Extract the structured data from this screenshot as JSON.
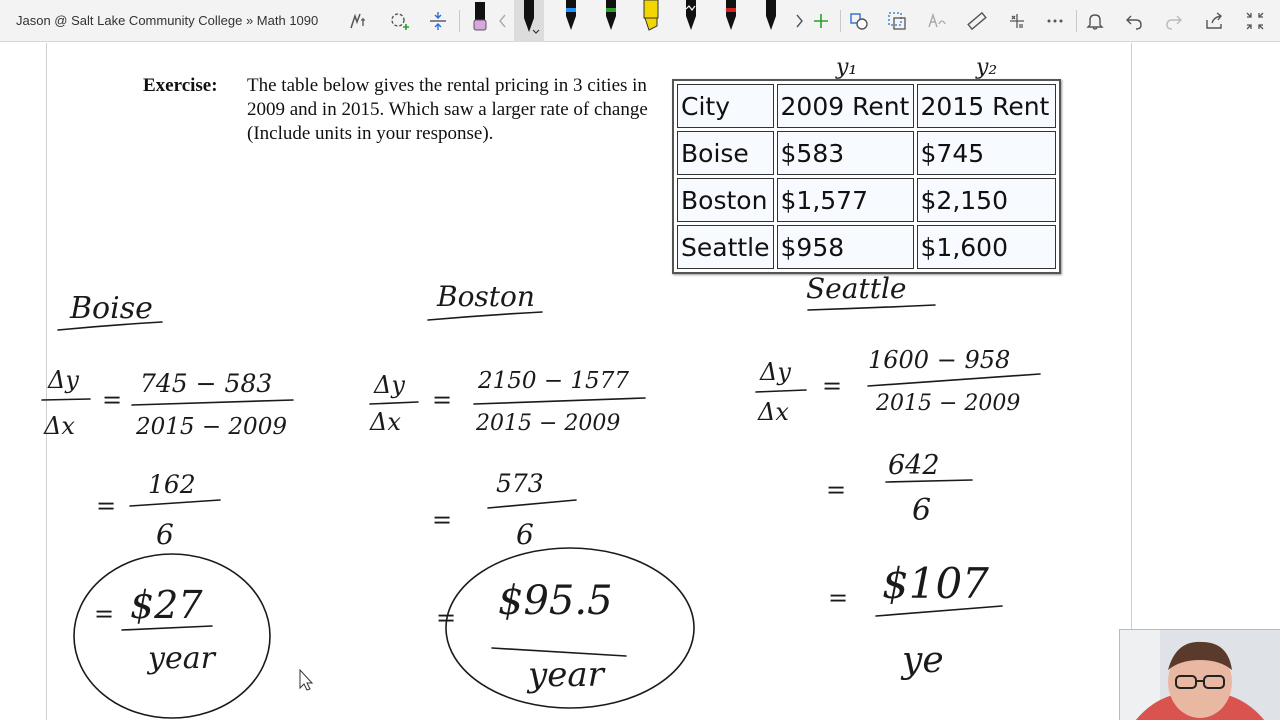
{
  "breadcrumb": "Jason @ Salt Lake Community College » Math 1090",
  "toolbar": {
    "icons": [
      "touch-writing-icon",
      "lasso-add-icon",
      "insert-space-icon",
      "highlighter-eraser-icon",
      "ruler-icon",
      "more-icon",
      "notifications-icon",
      "undo-icon",
      "redo-icon",
      "share-icon",
      "fullscreen-icon"
    ],
    "pen_colors": [
      "#111111",
      "#1e90ff",
      "#2aa02a",
      "#f2d600",
      "#111111",
      "#d32020",
      "#111111"
    ],
    "accent": "#2aa02a"
  },
  "exercise": {
    "label": "Exercise:",
    "text": "The table below gives the rental pricing in 3 cities in 2009 and in 2015. Which saw a larger rate of change (Include units in your response)."
  },
  "rent_table": {
    "headers": [
      "City",
      "2009 Rent",
      "2015 Rent"
    ],
    "rows": [
      [
        "Boise",
        "$583",
        "$745"
      ],
      [
        "Boston",
        "$1,577",
        "$2,150"
      ],
      [
        "Seattle",
        "$958",
        "$1,600"
      ]
    ]
  },
  "ink": {
    "y1": "y₁",
    "y2": "y₂",
    "boise": {
      "title": "Boise",
      "dy": "Δy",
      "dx": "Δx",
      "eq": "=",
      "num": "745 − 583",
      "den": "2015 − 2009",
      "num2": "162",
      "den2": "6",
      "result": "$27",
      "unit": "year"
    },
    "boston": {
      "title": "Boston",
      "dy": "Δy",
      "dx": "Δx",
      "eq": "=",
      "num": "2150 − 1577",
      "den": "2015 − 2009",
      "num2": "573",
      "den2": "6",
      "result": "$95.5",
      "unit": "year"
    },
    "seattle": {
      "title": "Seattle",
      "dy": "Δy",
      "dx": "Δx",
      "eq": "=",
      "num": "1600 − 958",
      "den": "2015 − 2009",
      "num2": "642",
      "den2": "6",
      "result": "$107",
      "unit": "ye"
    }
  }
}
